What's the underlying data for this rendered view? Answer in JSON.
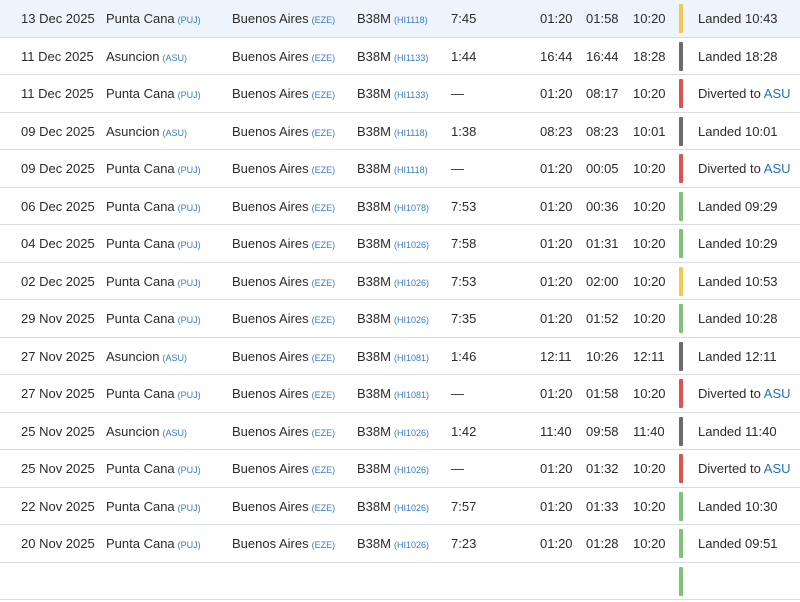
{
  "status_colors": {
    "green": "#7cc576",
    "yellow": "#f2c94c",
    "gray": "#6b6b6b",
    "red": "#d9534f"
  },
  "rows": [
    {
      "date": "13 Dec 2025",
      "from_city": "Punta Cana",
      "from_code": "(PUJ)",
      "to_city": "Buenos Aires",
      "to_code": "(EZE)",
      "aircraft": "B38M",
      "flight": "(HI1118)",
      "duration": "7:45",
      "std": "01:20",
      "atd": "01:58",
      "sta": "10:20",
      "status_text": "Landed 10:43",
      "status_link": "",
      "status_color": "yellow"
    },
    {
      "date": "11 Dec 2025",
      "from_city": "Asuncion",
      "from_code": "(ASU)",
      "to_city": "Buenos Aires",
      "to_code": "(EZE)",
      "aircraft": "B38M",
      "flight": "(HI1133)",
      "duration": "1:44",
      "std": "16:44",
      "atd": "16:44",
      "sta": "18:28",
      "status_text": "Landed 18:28",
      "status_link": "",
      "status_color": "gray"
    },
    {
      "date": "11 Dec 2025",
      "from_city": "Punta Cana",
      "from_code": "(PUJ)",
      "to_city": "Buenos Aires",
      "to_code": "(EZE)",
      "aircraft": "B38M",
      "flight": "(HI1133)",
      "duration": "—",
      "std": "01:20",
      "atd": "08:17",
      "sta": "10:20",
      "status_text": "Diverted to",
      "status_link": "ASU",
      "status_color": "red"
    },
    {
      "date": "09 Dec 2025",
      "from_city": "Asuncion",
      "from_code": "(ASU)",
      "to_city": "Buenos Aires",
      "to_code": "(EZE)",
      "aircraft": "B38M",
      "flight": "(HI1118)",
      "duration": "1:38",
      "std": "08:23",
      "atd": "08:23",
      "sta": "10:01",
      "status_text": "Landed 10:01",
      "status_link": "",
      "status_color": "gray"
    },
    {
      "date": "09 Dec 2025",
      "from_city": "Punta Cana",
      "from_code": "(PUJ)",
      "to_city": "Buenos Aires",
      "to_code": "(EZE)",
      "aircraft": "B38M",
      "flight": "(HI1118)",
      "duration": "—",
      "std": "01:20",
      "atd": "00:05",
      "sta": "10:20",
      "status_text": "Diverted to",
      "status_link": "ASU",
      "status_color": "red"
    },
    {
      "date": "06 Dec 2025",
      "from_city": "Punta Cana",
      "from_code": "(PUJ)",
      "to_city": "Buenos Aires",
      "to_code": "(EZE)",
      "aircraft": "B38M",
      "flight": "(HI1078)",
      "duration": "7:53",
      "std": "01:20",
      "atd": "00:36",
      "sta": "10:20",
      "status_text": "Landed 09:29",
      "status_link": "",
      "status_color": "green"
    },
    {
      "date": "04 Dec 2025",
      "from_city": "Punta Cana",
      "from_code": "(PUJ)",
      "to_city": "Buenos Aires",
      "to_code": "(EZE)",
      "aircraft": "B38M",
      "flight": "(HI1026)",
      "duration": "7:58",
      "std": "01:20",
      "atd": "01:31",
      "sta": "10:20",
      "status_text": "Landed 10:29",
      "status_link": "",
      "status_color": "green"
    },
    {
      "date": "02 Dec 2025",
      "from_city": "Punta Cana",
      "from_code": "(PUJ)",
      "to_city": "Buenos Aires",
      "to_code": "(EZE)",
      "aircraft": "B38M",
      "flight": "(HI1026)",
      "duration": "7:53",
      "std": "01:20",
      "atd": "02:00",
      "sta": "10:20",
      "status_text": "Landed 10:53",
      "status_link": "",
      "status_color": "yellow"
    },
    {
      "date": "29 Nov 2025",
      "from_city": "Punta Cana",
      "from_code": "(PUJ)",
      "to_city": "Buenos Aires",
      "to_code": "(EZE)",
      "aircraft": "B38M",
      "flight": "(HI1026)",
      "duration": "7:35",
      "std": "01:20",
      "atd": "01:52",
      "sta": "10:20",
      "status_text": "Landed 10:28",
      "status_link": "",
      "status_color": "green"
    },
    {
      "date": "27 Nov 2025",
      "from_city": "Asuncion",
      "from_code": "(ASU)",
      "to_city": "Buenos Aires",
      "to_code": "(EZE)",
      "aircraft": "B38M",
      "flight": "(HI1081)",
      "duration": "1:46",
      "std": "12:11",
      "atd": "10:26",
      "sta": "12:11",
      "status_text": "Landed 12:11",
      "status_link": "",
      "status_color": "gray"
    },
    {
      "date": "27 Nov 2025",
      "from_city": "Punta Cana",
      "from_code": "(PUJ)",
      "to_city": "Buenos Aires",
      "to_code": "(EZE)",
      "aircraft": "B38M",
      "flight": "(HI1081)",
      "duration": "—",
      "std": "01:20",
      "atd": "01:58",
      "sta": "10:20",
      "status_text": "Diverted to",
      "status_link": "ASU",
      "status_color": "red"
    },
    {
      "date": "25 Nov 2025",
      "from_city": "Asuncion",
      "from_code": "(ASU)",
      "to_city": "Buenos Aires",
      "to_code": "(EZE)",
      "aircraft": "B38M",
      "flight": "(HI1026)",
      "duration": "1:42",
      "std": "11:40",
      "atd": "09:58",
      "sta": "11:40",
      "status_text": "Landed 11:40",
      "status_link": "",
      "status_color": "gray"
    },
    {
      "date": "25 Nov 2025",
      "from_city": "Punta Cana",
      "from_code": "(PUJ)",
      "to_city": "Buenos Aires",
      "to_code": "(EZE)",
      "aircraft": "B38M",
      "flight": "(HI1026)",
      "duration": "—",
      "std": "01:20",
      "atd": "01:32",
      "sta": "10:20",
      "status_text": "Diverted to",
      "status_link": "ASU",
      "status_color": "red"
    },
    {
      "date": "22 Nov 2025",
      "from_city": "Punta Cana",
      "from_code": "(PUJ)",
      "to_city": "Buenos Aires",
      "to_code": "(EZE)",
      "aircraft": "B38M",
      "flight": "(HI1026)",
      "duration": "7:57",
      "std": "01:20",
      "atd": "01:33",
      "sta": "10:20",
      "status_text": "Landed 10:30",
      "status_link": "",
      "status_color": "green"
    },
    {
      "date": "20 Nov 2025",
      "from_city": "Punta Cana",
      "from_code": "(PUJ)",
      "to_city": "Buenos Aires",
      "to_code": "(EZE)",
      "aircraft": "B38M",
      "flight": "(HI1026)",
      "duration": "7:23",
      "std": "01:20",
      "atd": "01:28",
      "sta": "10:20",
      "status_text": "Landed 09:51",
      "status_link": "",
      "status_color": "green"
    },
    {
      "date": "",
      "from_city": "",
      "from_code": "",
      "to_city": "",
      "to_code": "",
      "aircraft": "",
      "flight": "",
      "duration": "",
      "std": "",
      "atd": "",
      "sta": "",
      "status_text": "",
      "status_link": "",
      "status_color": "green"
    }
  ]
}
